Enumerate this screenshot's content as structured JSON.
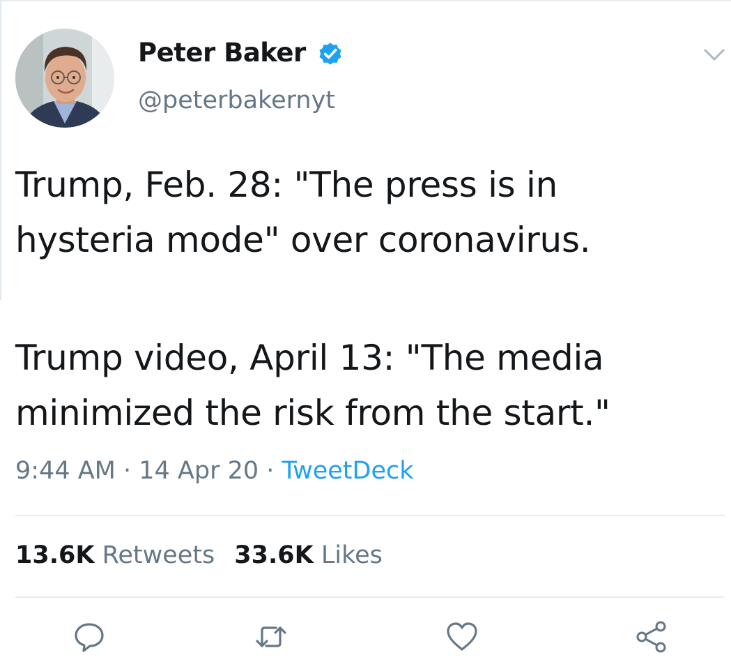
{
  "author": {
    "display_name": "Peter Baker",
    "handle": "@peterbakernyt",
    "verified": true,
    "avatar_icon": "profile-photo"
  },
  "tweet": {
    "lines": [
      "Trump, Feb. 28: \"The press is in",
      "hysteria mode\" over coronavirus.",
      "Trump video, April 13: \"The media",
      "minimized the risk from the start.\""
    ]
  },
  "meta": {
    "time": "9:44 AM",
    "separator": " · ",
    "date": "14 Apr 20",
    "source": "TweetDeck"
  },
  "stats": {
    "retweets_count": "13.6K",
    "retweets_label": "Retweets",
    "likes_count": "33.6K",
    "likes_label": "Likes"
  },
  "actions": {
    "reply_icon": "reply-icon",
    "retweet_icon": "retweet-icon",
    "like_icon": "like-icon",
    "share_icon": "share-icon"
  },
  "colors": {
    "accent": "#1da1f2",
    "secondary_text": "#657786",
    "primary_text": "#14171a",
    "divider": "#e6ecf0"
  }
}
